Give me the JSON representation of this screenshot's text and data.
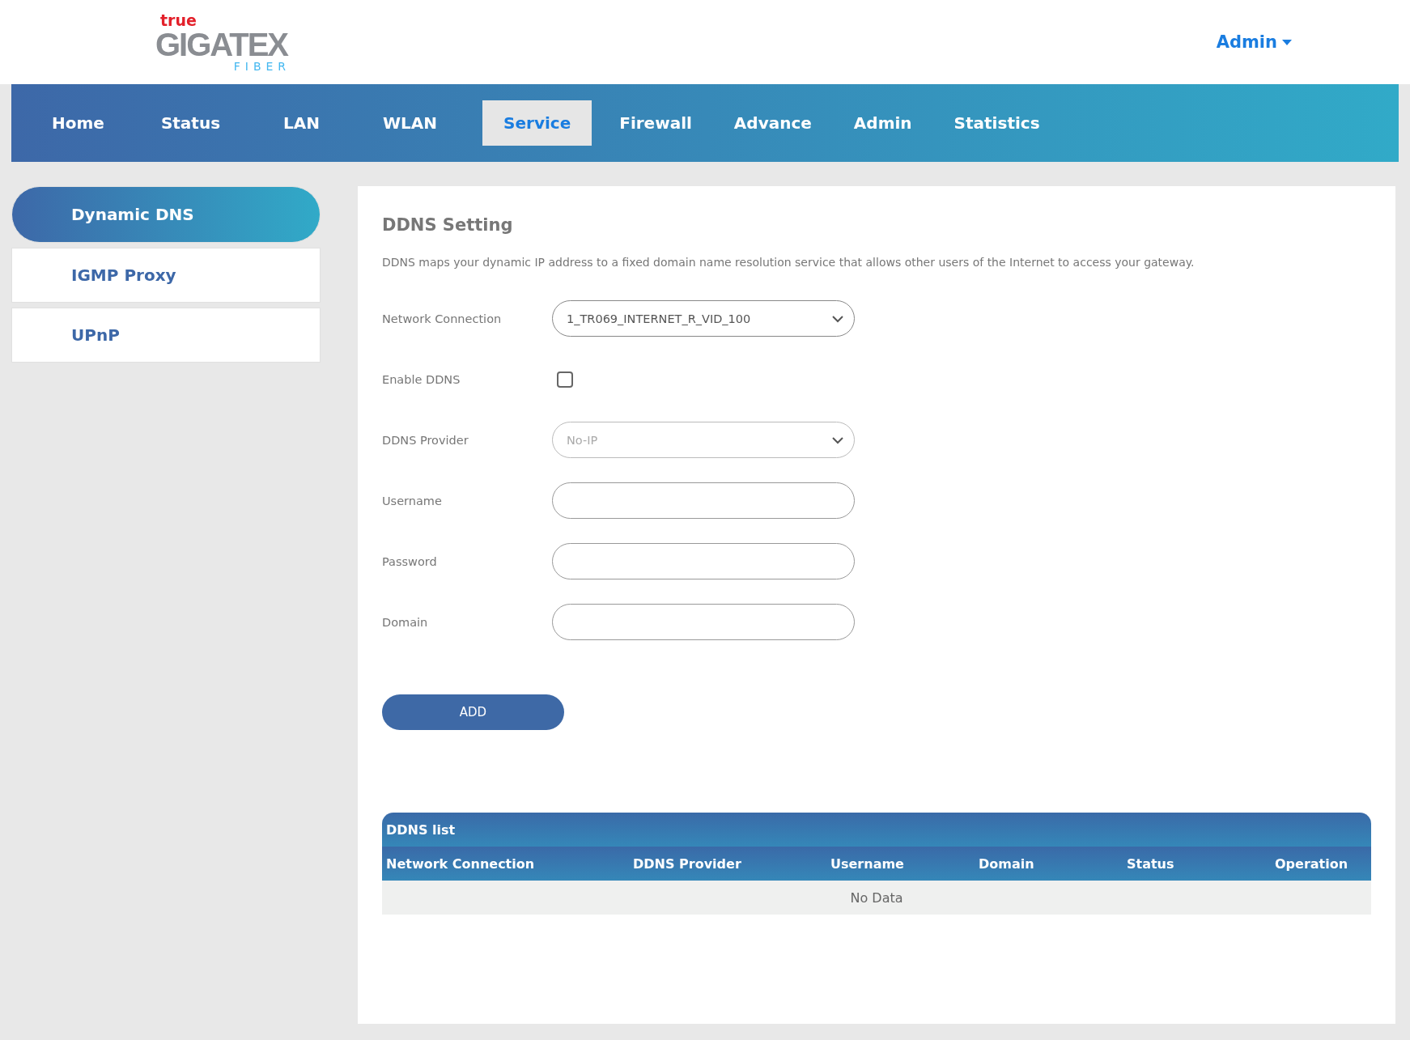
{
  "logo": {
    "brand": "true",
    "name": "GIGATEX",
    "sub": "FIBER"
  },
  "user_menu": {
    "label": "Admin"
  },
  "nav": [
    {
      "label": "Home",
      "selected": false
    },
    {
      "label": "Status",
      "selected": false
    },
    {
      "label": "LAN",
      "selected": false
    },
    {
      "label": "WLAN",
      "selected": false
    },
    {
      "label": "Service",
      "selected": true
    },
    {
      "label": "Firewall",
      "selected": false
    },
    {
      "label": "Advance",
      "selected": false
    },
    {
      "label": "Admin",
      "selected": false
    },
    {
      "label": "Statistics",
      "selected": false
    }
  ],
  "sidebar": {
    "items": [
      {
        "label": "Dynamic DNS",
        "selected": true
      },
      {
        "label": "IGMP Proxy",
        "selected": false
      },
      {
        "label": "UPnP",
        "selected": false
      }
    ]
  },
  "panel": {
    "title": "DDNS Setting",
    "description": "DDNS maps your dynamic IP address to a fixed domain name resolution service that allows other users of the Internet to access your gateway.",
    "fields": [
      {
        "kind": "select",
        "label": "Network Connection",
        "value": "1_TR069_INTERNET_R_VID_100",
        "disabled": false
      },
      {
        "kind": "checkbox",
        "label": "Enable DDNS",
        "checked": false
      },
      {
        "kind": "select",
        "label": "DDNS Provider",
        "value": "No-IP",
        "disabled": true
      },
      {
        "kind": "text",
        "label": "Username"
      },
      {
        "kind": "password",
        "label": "Password"
      },
      {
        "kind": "text",
        "label": "Domain"
      }
    ],
    "button": "ADD",
    "table": {
      "title": "DDNS list",
      "columns": [
        "Network Connection",
        "DDNS Provider",
        "Username",
        "Domain",
        "Status",
        "Operation"
      ],
      "empty": "No Data"
    }
  }
}
